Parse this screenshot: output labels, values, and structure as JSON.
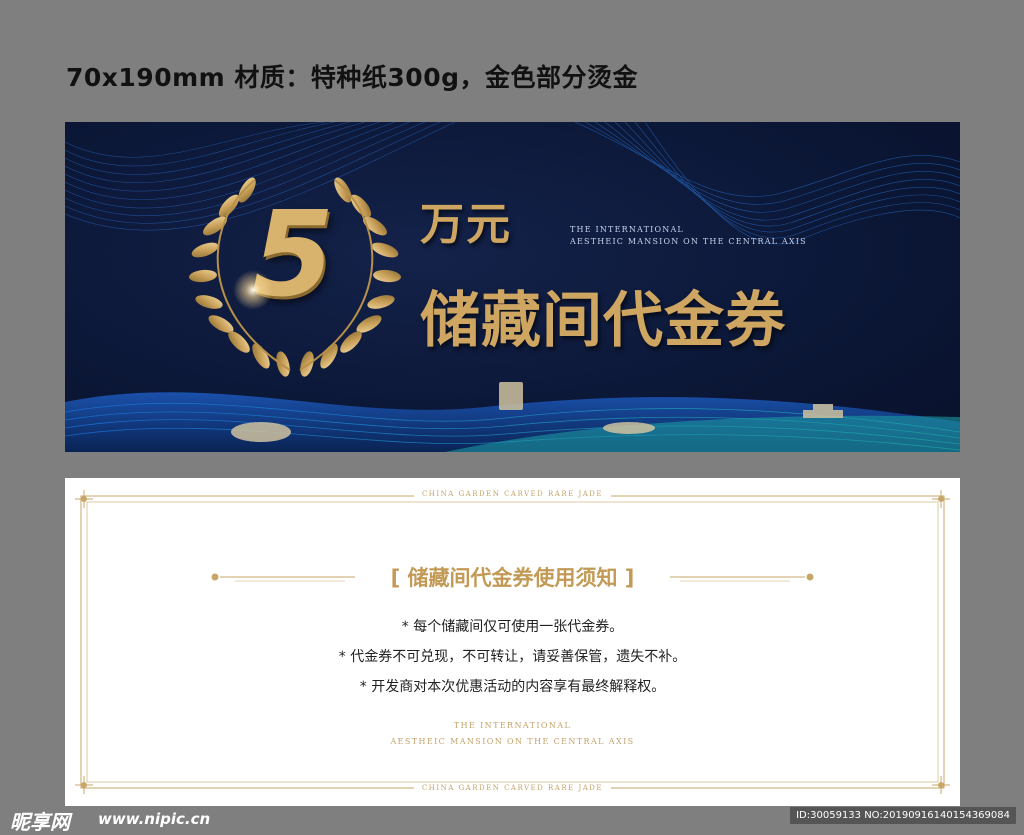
{
  "spec_text": "70x190mm 材质：特种纸300g，金色部分烫金",
  "front": {
    "number": "5",
    "amount": "万元",
    "en_line1": "THE INTERNATIONAL",
    "en_line2": "AESTHEIC MANSION ON THE CENTRAL AXIS",
    "title": "储藏间代金券",
    "colors": {
      "background": "#0c1838",
      "gold": "#cfa661",
      "wave_blue": "#1b5fc4",
      "wave_teal": "#1fa0a8"
    },
    "icons": [
      "laurel-wreath-icon",
      "building-silhouette-icon"
    ]
  },
  "back": {
    "en_top": "CHINA GARDEN CARVED RARE JADE",
    "notice_title": "[ 储藏间代金券使用须知 ]",
    "rules": [
      "* 每个储藏间仅可使用一张代金券。",
      "* 代金券不可兑现，不可转让，请妥善保管，遗失不补。",
      "* 开发商对本次优惠活动的内容享有最终解释权。"
    ],
    "en_line1": "THE INTERNATIONAL",
    "en_line2": "AESTHEIC MANSION ON THE CENTRAL AXIS",
    "en_bottom": "CHINA GARDEN CARVED RARE JADE",
    "colors": {
      "background": "#ffffff",
      "gold": "#c29a55"
    }
  },
  "watermark": {
    "logo": "昵享网",
    "url": "www.nipic.cn",
    "id": "ID:30059133 NO:20190916140154369084"
  }
}
